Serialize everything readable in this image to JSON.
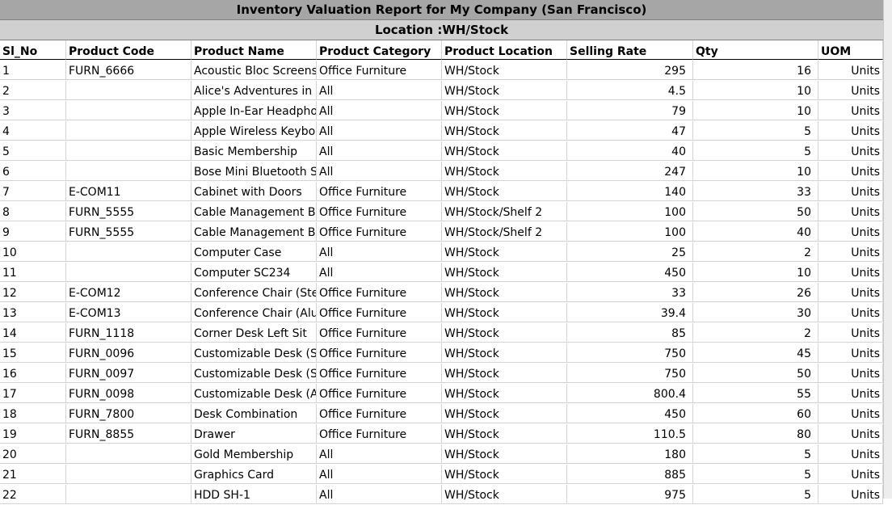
{
  "report": {
    "title": "Inventory Valuation Report for My Company (San Francisco)",
    "location": "Location :WH/Stock"
  },
  "table": {
    "columns": [
      "Sl_No",
      "Product Code",
      "Product Name",
      "Product Category",
      "Product Location",
      "Selling Rate",
      "Qty",
      "UOM"
    ],
    "rows": [
      [
        "1",
        "FURN_6666",
        "Acoustic Bloc Screens",
        "Office Furniture",
        "WH/Stock",
        "295",
        "16",
        "Units"
      ],
      [
        "2",
        "",
        "Alice's Adventures in W",
        "All",
        "WH/Stock",
        "4.5",
        "10",
        "Units"
      ],
      [
        "3",
        "",
        "Apple In-Ear Headphones",
        "All",
        "WH/Stock",
        "79",
        "10",
        "Units"
      ],
      [
        "4",
        "",
        "Apple Wireless Keyboard",
        "All",
        "WH/Stock",
        "47",
        "5",
        "Units"
      ],
      [
        "5",
        "",
        "Basic Membership",
        "All",
        "WH/Stock",
        "40",
        "5",
        "Units"
      ],
      [
        "6",
        "",
        "Bose Mini Bluetooth Sp",
        "All",
        "WH/Stock",
        "247",
        "10",
        "Units"
      ],
      [
        "7",
        "E-COM11",
        "Cabinet with Doors",
        "Office Furniture",
        "WH/Stock",
        "140",
        "33",
        "Units"
      ],
      [
        "8",
        "FURN_5555",
        "Cable Management Box",
        "Office Furniture",
        "WH/Stock/Shelf 2",
        "100",
        "50",
        "Units"
      ],
      [
        "9",
        "FURN_5555",
        "Cable Management Box",
        "Office Furniture",
        "WH/Stock/Shelf 2",
        "100",
        "40",
        "Units"
      ],
      [
        "10",
        "",
        "Computer Case",
        "All",
        "WH/Stock",
        "25",
        "2",
        "Units"
      ],
      [
        "11",
        "",
        "Computer SC234",
        "All",
        "WH/Stock",
        "450",
        "10",
        "Units"
      ],
      [
        "12",
        "E-COM12",
        "Conference Chair (Steel)",
        "Office Furniture",
        "WH/Stock",
        "33",
        "26",
        "Units"
      ],
      [
        "13",
        "E-COM13",
        "Conference Chair (Aluminium)",
        "Office Furniture",
        "WH/Stock",
        "39.4",
        "30",
        "Units"
      ],
      [
        "14",
        "FURN_1118",
        "Corner Desk Left Sit",
        "Office Furniture",
        "WH/Stock",
        "85",
        "2",
        "Units"
      ],
      [
        "15",
        "FURN_0096",
        "Customizable Desk (Steel)",
        "Office Furniture",
        "WH/Stock",
        "750",
        "45",
        "Units"
      ],
      [
        "16",
        "FURN_0097",
        "Customizable Desk (Steel)",
        "Office Furniture",
        "WH/Stock",
        "750",
        "50",
        "Units"
      ],
      [
        "17",
        "FURN_0098",
        "Customizable Desk (Aluminium)",
        "Office Furniture",
        "WH/Stock",
        "800.4",
        "55",
        "Units"
      ],
      [
        "18",
        "FURN_7800",
        "Desk Combination",
        "Office Furniture",
        "WH/Stock",
        "450",
        "60",
        "Units"
      ],
      [
        "19",
        "FURN_8855",
        "Drawer",
        "Office Furniture",
        "WH/Stock",
        "110.5",
        "80",
        "Units"
      ],
      [
        "20",
        "",
        "Gold Membership",
        "All",
        "WH/Stock",
        "180",
        "5",
        "Units"
      ],
      [
        "21",
        "",
        "Graphics Card",
        "All",
        "WH/Stock",
        "885",
        "5",
        "Units"
      ],
      [
        "22",
        "",
        "HDD SH-1",
        "All",
        "WH/Stock",
        "975",
        "5",
        "Units"
      ]
    ]
  }
}
